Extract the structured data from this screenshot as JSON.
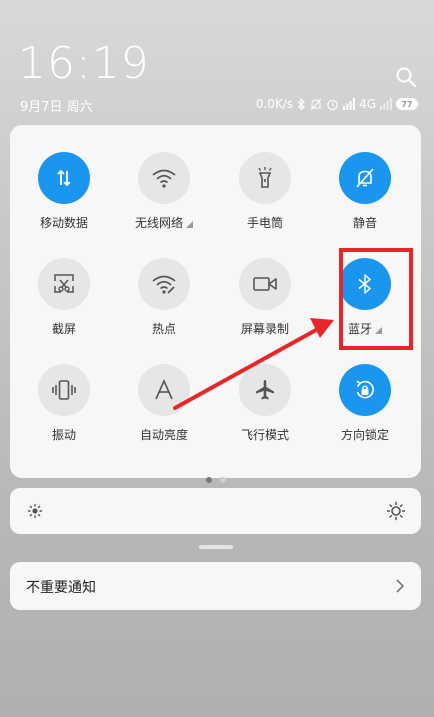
{
  "status_bar": {
    "time": "16:19",
    "date": "9月7日 周六",
    "network_speed": "0.0K/s",
    "network_type": "4G",
    "battery_level": "77"
  },
  "toggles": [
    {
      "label": "移动数据",
      "icon": "mobile-data-icon",
      "active": true
    },
    {
      "label": "无线网络",
      "icon": "wifi-icon",
      "active": false,
      "expandable": true
    },
    {
      "label": "手电筒",
      "icon": "flashlight-icon",
      "active": false
    },
    {
      "label": "静音",
      "icon": "mute-bell-icon",
      "active": true
    },
    {
      "label": "截屏",
      "icon": "screenshot-icon",
      "active": false
    },
    {
      "label": "热点",
      "icon": "hotspot-icon",
      "active": false
    },
    {
      "label": "屏幕录制",
      "icon": "screen-record-icon",
      "active": false
    },
    {
      "label": "蓝牙",
      "icon": "bluetooth-icon",
      "active": true,
      "expandable": true
    },
    {
      "label": "振动",
      "icon": "vibrate-icon",
      "active": false
    },
    {
      "label": "自动亮度",
      "icon": "auto-brightness-icon",
      "active": false
    },
    {
      "label": "飞行模式",
      "icon": "airplane-icon",
      "active": false
    },
    {
      "label": "方向锁定",
      "icon": "rotation-lock-icon",
      "active": true
    }
  ],
  "pager": {
    "pages": 2,
    "current": 1
  },
  "notifications": {
    "unimportant_label": "不重要通知"
  },
  "colors": {
    "accent": "#1b96ef",
    "annotation": "#e8262a",
    "panel": "#f7f7f7"
  }
}
